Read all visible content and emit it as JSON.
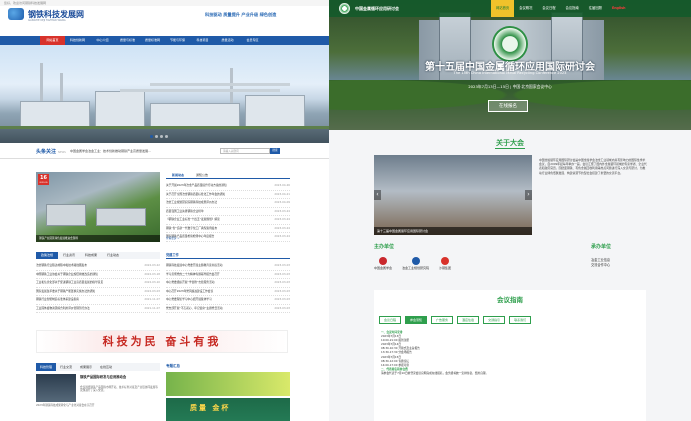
{
  "left": {
    "topbar": "您好，欢迎访问钢铁科技发展网",
    "logo_title": "钢铁科技发展网",
    "logo_sub": "GANGTIE KEJI FAZHAN WANG",
    "slogan": "科技驱动 质量提升 产业升级 绿色创造",
    "nav": [
      "网站首页",
      "科技创新网",
      "中心介绍",
      "质量与标准",
      "质量标准网",
      "节能与环保",
      "科技项目",
      "质量活动",
      "会员专区"
    ],
    "news_label": "头条关注",
    "news_label_sub": "NEWS",
    "news_headline": "中国金属学会冶金工业：技术创新推动钢铁产业高质量发展…",
    "search_placeholder": "请输入关键词",
    "search_btn": "搜索",
    "photo_date_day": "16",
    "photo_date_month": "2023-05",
    "photo_caption": "钢铁产业园区绿色发展推进会现场",
    "news_tabs": [
      "新闻动态",
      "通知公告"
    ],
    "news_rows": [
      {
        "t": "关于开展2023年冶金产品质量提升行动方案的通知",
        "d": "2023-04-26"
      },
      {
        "t": "关于召开全国冶金钢铁质量标准化工作年会的通知",
        "d": "2023-04-21"
      },
      {
        "t": "冶金工业规划研究院钢铁科技成果评价办法",
        "d": "2023-04-09"
      },
      {
        "t": "质量强国工业先锋钢铁企业榜单",
        "d": "2023-03-24"
      },
      {
        "t": "《钢铁企业工业标准“十四五”发展规划》解读",
        "d": "2023-03-24"
      },
      {
        "t": "钢铁“智”造新一代数字化工厂典型案例发布",
        "d": "2023-03-24"
      },
      {
        "t": "国家钢铁产品质量检验检测中心年度报告",
        "d": "2023-03-24"
      }
    ],
    "more": "查看更多 >",
    "sec2_tabs": [
      "政策法规",
      "行业资讯",
      "科技成果",
      "行业动态"
    ],
    "sec2_rows": [
      {
        "t": "冶金钢铁行业碳达峰碳中和技术路线图发布",
        "d": "2022-03-22"
      },
      {
        "t": "中国钢铁工业协会关于钢铁企业超低排放改造的通知",
        "d": "2022-03-18"
      },
      {
        "t": "工业和信息化部关于促进钢铁工业高质量发展的指导意见",
        "d": "2022-03-10"
      },
      {
        "t": "国家发展改革委关于钢铁产能置换实施办法的通知",
        "d": "2022-03-03"
      },
      {
        "t": "钢铁行业智能制造标准体系建设指南",
        "d": "2021-11-07"
      },
      {
        "t": "工业固体废物资源综合利用评价管理暂行办法",
        "d": "2021-11-07"
      }
    ],
    "sec3_title": "党建工作",
    "sec3_rows": [
      {
        "t": "钢铁科技发展中心党委开展主题教育读书班活动",
        "d": "2023-03-03"
      },
      {
        "t": "学习贯彻党的二十大精神专题辅导报告会召开",
        "d": "2023-03-03"
      },
      {
        "t": "中心党委组织开展“学雷锋”志愿服务活动",
        "d": "2023-03-03"
      },
      {
        "t": "中心召开2023年党风廉政建设工作会议",
        "d": "2023-03-03"
      },
      {
        "t": "中心党委理论学习中心组开展集体学习",
        "d": "2023-03-03"
      },
      {
        "t": "党支部开展“不忘初心、牢记使命”主题党日活动",
        "d": "2023-03-03"
      }
    ],
    "banner": "科技为民  奋斗有我",
    "sec4_tabs": [
      "科技管理",
      "行业交流",
      "成果展示",
      "在线互动"
    ],
    "thumb_title": "钢铁产品国际研发与应用推动会",
    "thumb_body": "会议围绕钢铁产品国际市场开拓、技术标准对接及产业链协同发展等议题进行了深入交流。",
    "thumb_foot": "2023年钢铁科技成果转化与产业化对接会在京召开",
    "gallery_title": "专题汇总",
    "gallery_text": "质量 金杯"
  },
  "right": {
    "brand": "中国金属循环应用研讨会",
    "menu": [
      "网站首页",
      "会议概况",
      "会议日程",
      "会议指南",
      "往届回顾",
      "English"
    ],
    "title": "第十五届中国金属循环应用国际研讨会",
    "subtitle": "The 15th China International Metal Recycling Conference 2023",
    "date": "2023年7月13日—15日 | 中国·北京国家会议中心",
    "btn": "在线报名",
    "about_title": "关于大会",
    "photo_caption": "第十三届中国金属循环应用国际研讨会",
    "about_text": "中国金属循环应用国际研讨会是中国金属学会冶金工业领域内具有影响力的国际性学术会议，自2009年起每年举办一届，会议汇聚了国内外金属循环领域的专家学者、企业代表和政府官员，围绕废钢铁、有色金属回收利用等热点问题进行深入交流与研讨，为推动行业绿色低碳发展、构建资源节约型社会搭建了重要的交流平台。",
    "host": "主办单位",
    "cohost": "承办单位",
    "host_logos": [
      "中国金属学会",
      "冶金工业规划研究院",
      "沙钢集团"
    ],
    "cohost_text": "冶金工业信息\n交流合作中心",
    "guide_title": "会议指南",
    "guide_tabs": [
      "会议日程",
      "参会须知",
      "广告服务",
      "酒店住宿",
      "交通指引",
      "联系我们"
    ],
    "guide_lines": [
      {
        "h": true,
        "t": "一、会议时间安排"
      },
      {
        "h": false,
        "t": "2023年7月13日"
      },
      {
        "h": false,
        "t": "10:00-21:00 报到注册"
      },
      {
        "h": false,
        "t": "2023年7月14日"
      },
      {
        "h": false,
        "t": "08:30-10:30 开幕式及主旨报告"
      },
      {
        "h": false,
        "t": "13:30-17:30 分会场报告"
      },
      {
        "h": false,
        "t": "2023年7月15日"
      },
      {
        "h": false,
        "t": "08:30-12:00 专题论坛"
      },
      {
        "h": false,
        "t": "14:00-17:00 参观考察"
      },
      {
        "h": true,
        "t": "二、代表报名和参会费"
      },
      {
        "h": false,
        "t": "请参会代表于7月10日前登录会议官网完成在线报名，会务组将统一安排住宿，费用自理。"
      }
    ]
  }
}
